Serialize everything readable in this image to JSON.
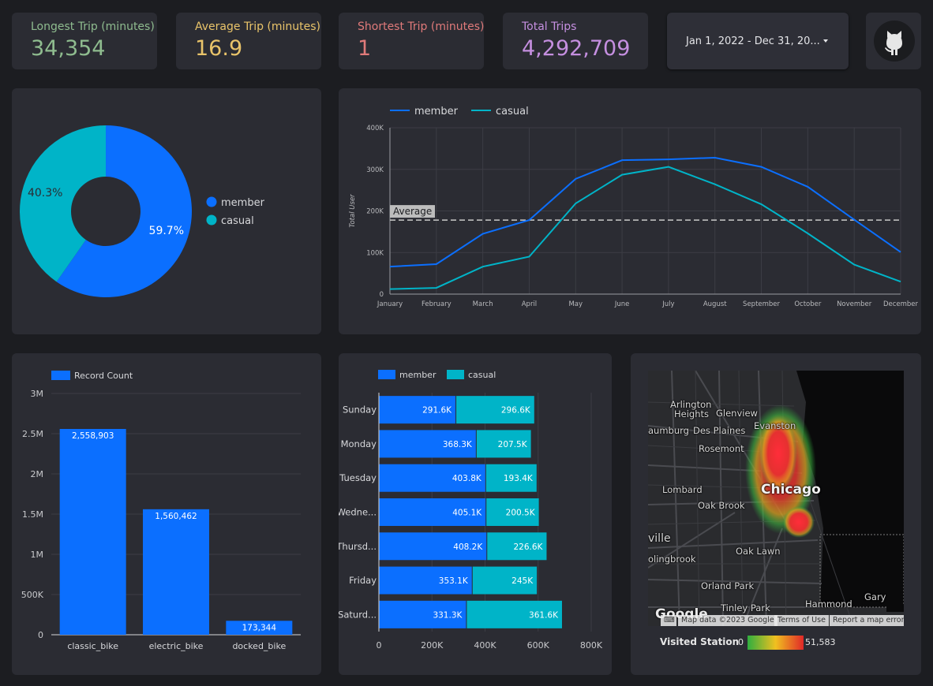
{
  "kpis": [
    {
      "label": "Longest Trip (minutes)",
      "value": "34,354",
      "color": "#8fbc8f"
    },
    {
      "label": "Average Trip (minutes)",
      "value": "16.9",
      "color": "#e9c46a"
    },
    {
      "label": "Shortest Trip (minutes)",
      "value": "1",
      "color": "#e07a7a"
    },
    {
      "label": "Total Trips",
      "value": "4,292,709",
      "color": "#c58fe0"
    }
  ],
  "date_range": {
    "label": "Jan 1, 2022 - Dec 31, 20..."
  },
  "github": {
    "icon": "github-icon"
  },
  "colors": {
    "member": "#0b6fff",
    "casual": "#00b4c8",
    "record": "#0b6fff",
    "bg": "#1c1d21",
    "card": "#2b2c33"
  },
  "chart_data": [
    {
      "type": "pie",
      "labels": [
        "member",
        "casual"
      ],
      "values": [
        59.7,
        40.3
      ],
      "value_labels": [
        "59.7%",
        "40.3%"
      ],
      "legend": "right"
    },
    {
      "type": "line",
      "categories": [
        "January",
        "February",
        "March",
        "April",
        "May",
        "June",
        "July",
        "August",
        "September",
        "October",
        "November",
        "December"
      ],
      "series": [
        {
          "name": "member",
          "values": [
            66000,
            72000,
            145000,
            178000,
            277000,
            322000,
            324000,
            328000,
            306000,
            258000,
            179000,
            101000
          ]
        },
        {
          "name": "casual",
          "values": [
            12000,
            15000,
            66000,
            90000,
            218000,
            287000,
            306000,
            264000,
            216000,
            146000,
            71000,
            30000
          ]
        }
      ],
      "reference_line": {
        "label": "Average",
        "value": 178000
      },
      "ylabel": "Total User",
      "yticks": [
        "0",
        "100K",
        "200K",
        "300K",
        "400K"
      ],
      "ylim": [
        0,
        400000
      ],
      "grid": true,
      "legend": "top-left"
    },
    {
      "type": "bar",
      "categories": [
        "classic_bike",
        "electric_bike",
        "docked_bike"
      ],
      "series": [
        {
          "name": "Record Count",
          "values": [
            2558903,
            1560462,
            173344
          ]
        }
      ],
      "value_labels": [
        "2,558,903",
        "1,560,462",
        "173,344"
      ],
      "yticks": [
        "0",
        "500K",
        "1M",
        "1.5M",
        "2M",
        "2.5M",
        "3M"
      ],
      "ylim": [
        0,
        3000000
      ],
      "grid": true,
      "legend": "top-left"
    },
    {
      "type": "bar",
      "orientation": "horizontal",
      "stacked": true,
      "categories": [
        "Sunday",
        "Monday",
        "Tuesday",
        "Wedne...",
        "Thursd...",
        "Friday",
        "Saturd..."
      ],
      "series": [
        {
          "name": "member",
          "values": [
            291600,
            368300,
            403800,
            405100,
            408200,
            353100,
            331300
          ],
          "labels": [
            "291.6K",
            "368.3K",
            "403.8K",
            "405.1K",
            "408.2K",
            "353.1K",
            "331.3K"
          ]
        },
        {
          "name": "casual",
          "values": [
            296600,
            207500,
            193400,
            200500,
            226600,
            245000,
            361600
          ],
          "labels": [
            "296.6K",
            "207.5K",
            "193.4K",
            "200.5K",
            "226.6K",
            "245K",
            "361.6K"
          ]
        }
      ],
      "xticks": [
        "0",
        "200K",
        "400K",
        "600K",
        "800K"
      ],
      "xlim": [
        0,
        800000
      ],
      "legend": "top-left"
    }
  ],
  "map": {
    "labels": [
      "Arlington",
      "Heights",
      "Glenview",
      "Evanston",
      "aumburg",
      "Des Plaines",
      "Rosemont",
      "Lombard",
      "Oak Brook",
      "Chicago",
      "ville",
      "olingbrook",
      "Oak Lawn",
      "Orland Park",
      "Tinley Park",
      "Hammond",
      "Gary"
    ],
    "google_logo": "Google",
    "attribution": [
      "Map data ©2023 Google",
      "Terms of Use",
      "Report a map error"
    ],
    "legend_title": "Visited Station",
    "legend_min": "0",
    "legend_max": "51,583"
  }
}
